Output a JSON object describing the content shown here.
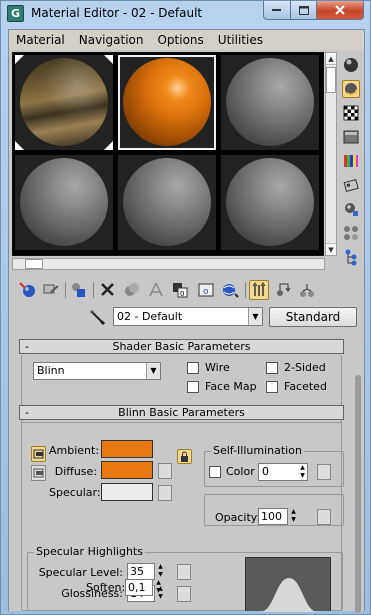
{
  "window": {
    "title": "Material Editor - 02 - Default",
    "app_icon_glyph": "G",
    "controls": [
      "minimize",
      "maximize",
      "close"
    ]
  },
  "menubar": [
    "Material",
    "Navigation",
    "Options",
    "Utilities"
  ],
  "slots": [
    {
      "kind": "checker",
      "active": false,
      "hot": true
    },
    {
      "kind": "orange",
      "active": true,
      "hot": false
    },
    {
      "kind": "gray",
      "active": false,
      "hot": false
    },
    {
      "kind": "gray",
      "active": false,
      "hot": false
    },
    {
      "kind": "gray",
      "active": false,
      "hot": false
    },
    {
      "kind": "gray",
      "active": false,
      "hot": false
    }
  ],
  "side_toolbar": [
    "sample-type-sphere-icon",
    "backlight-icon",
    "background-checker-icon",
    "sample-uv-tiling-icon",
    "video-color-check-icon",
    "make-preview-icon",
    "options-icon",
    "select-by-material-icon",
    "material-map-navigator-icon"
  ],
  "bottom_toolbar": [
    "get-material-icon",
    "put-to-scene-icon",
    "assign-to-selection-icon",
    "reset-map-icon",
    "make-unique-icon",
    "put-to-library-icon",
    "material-id-channel-icon",
    "show-map-icon",
    "show-end-result-icon",
    "go-to-parent-icon",
    "go-forward-icon",
    "go-to-sibling-icon"
  ],
  "material": {
    "name": "02 - Default",
    "type_button": "Standard"
  },
  "shader_rollout": {
    "title": "Shader Basic Parameters",
    "collapse_glyph": "-",
    "shader": "Blinn",
    "options": {
      "wire": "Wire",
      "two_sided": "2-Sided",
      "face_map": "Face Map",
      "faceted": "Faceted"
    }
  },
  "blinn_rollout": {
    "title": "Blinn Basic Parameters",
    "collapse_glyph": "-",
    "ambient_label": "Ambient:",
    "diffuse_label": "Diffuse:",
    "specular_label": "Specular:",
    "ambient_color": "#e87810",
    "diffuse_color": "#e87810",
    "specular_color": "#ececec",
    "self_illum": {
      "title": "Self-Illumination",
      "color_label": "Color",
      "value": "0"
    },
    "opacity_label": "Opacity:",
    "opacity_value": "100",
    "specular_highlights": {
      "title": "Specular Highlights",
      "level_label": "Specular Level:",
      "level_value": "35",
      "glossiness_label": "Glossiness:",
      "glossiness_value": "14",
      "soften_label": "Soften:",
      "soften_value": "0,1"
    }
  }
}
